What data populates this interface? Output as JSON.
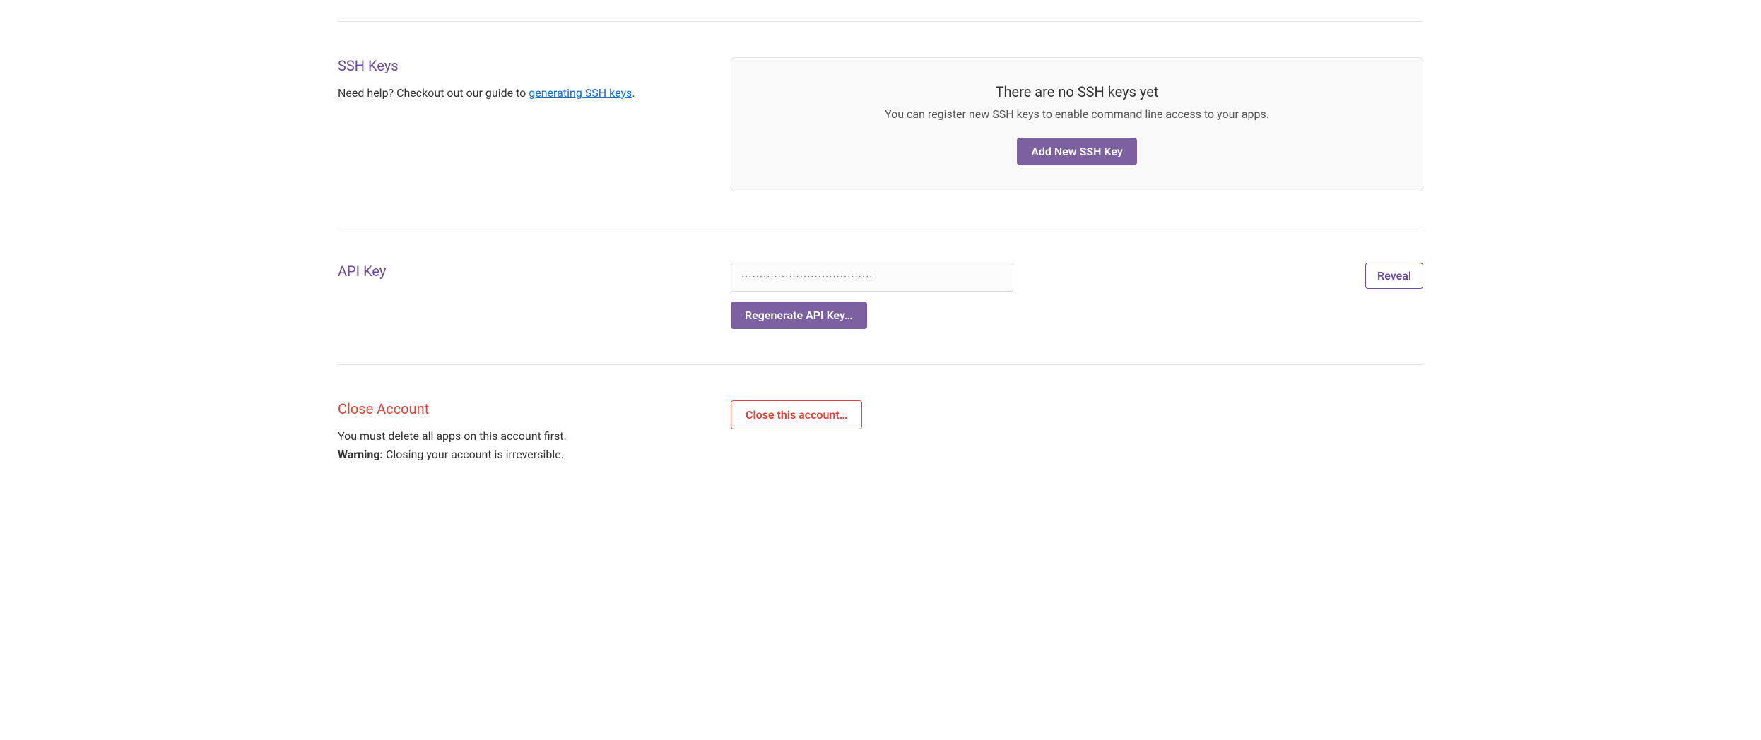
{
  "ssh": {
    "title": "SSH Keys",
    "desc_prefix": "Need help? Checkout out our guide to ",
    "link_text": "generating SSH keys",
    "desc_suffix": ".",
    "panel_title": "There are no SSH keys yet",
    "panel_desc": "You can register new SSH keys to enable command line access to your apps.",
    "add_button": "Add New SSH Key"
  },
  "api": {
    "title": "API Key",
    "value": "····································",
    "regenerate_button": "Regenerate API Key…",
    "reveal_button": "Reveal"
  },
  "close": {
    "title": "Close Account",
    "desc_line1": "You must delete all apps on this account first.",
    "warning_label": "Warning:",
    "warning_text": " Closing your account is irreversible.",
    "button": "Close this account…"
  }
}
